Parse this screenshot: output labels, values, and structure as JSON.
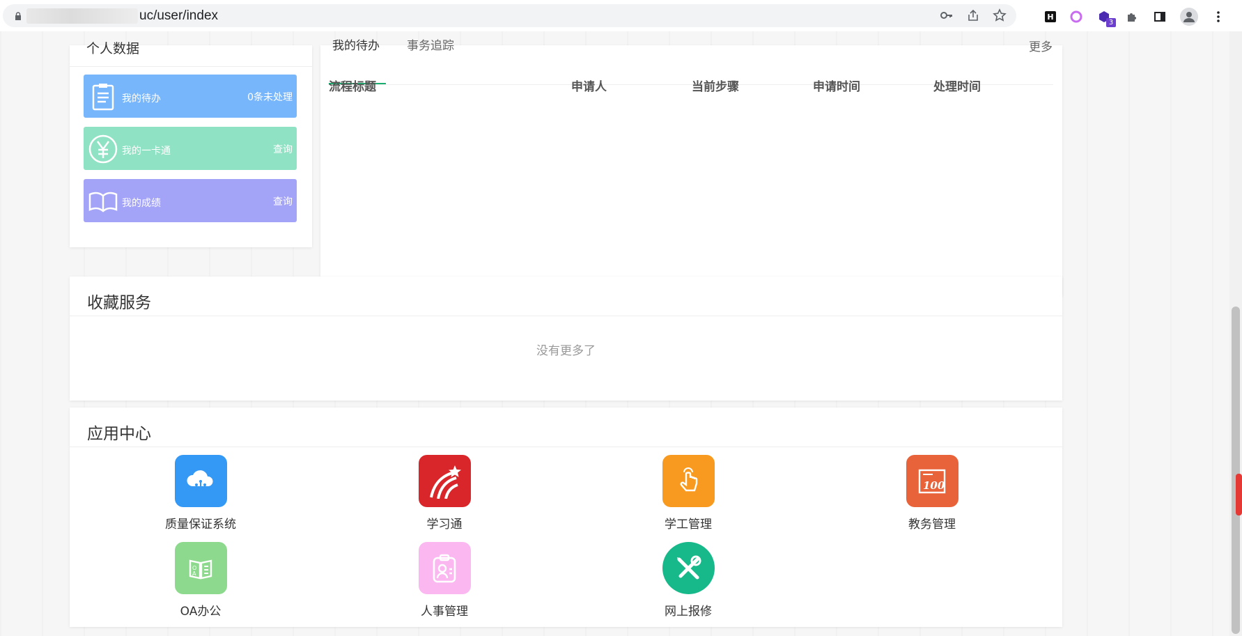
{
  "browser": {
    "url": "uc/user/index",
    "extension_badge": "3",
    "ext_h_label": "H"
  },
  "personal": {
    "title": "个人数据",
    "tiles": [
      {
        "label": "我的待办",
        "action": "0条未处理",
        "color": "#78b6fb"
      },
      {
        "label": "我的一卡通",
        "action": "查询",
        "color": "#8fe2c4"
      },
      {
        "label": "我的成绩",
        "action": "查询",
        "color": "#a3a3f7"
      }
    ]
  },
  "process": {
    "tabs": [
      "我的待办",
      "事务追踪"
    ],
    "more": "更多",
    "columns": [
      "流程标题",
      "申请人",
      "当前步骤",
      "申请时间",
      "处理时间"
    ]
  },
  "favorites": {
    "title": "收藏服务",
    "empty": "没有更多了"
  },
  "apps": {
    "title": "应用中心",
    "items": [
      {
        "label": "质量保证系统",
        "color": "#3498f5",
        "icon": "cloud-icon"
      },
      {
        "label": "学习通",
        "color": "#d8262a",
        "icon": "xuexitong-icon"
      },
      {
        "label": "学工管理",
        "color": "#f89a1f",
        "icon": "pointer-hand-icon"
      },
      {
        "label": "教务管理",
        "color": "#e8633a",
        "icon": "score-100-icon"
      },
      {
        "label": "OA办公",
        "color": "#8dd98d",
        "icon": "oa-book-icon"
      },
      {
        "label": "人事管理",
        "color": "#fbb8f0",
        "icon": "person-clipboard-icon"
      },
      {
        "label": "网上报修",
        "color": "#17b98b",
        "icon": "tools-icon"
      }
    ]
  }
}
